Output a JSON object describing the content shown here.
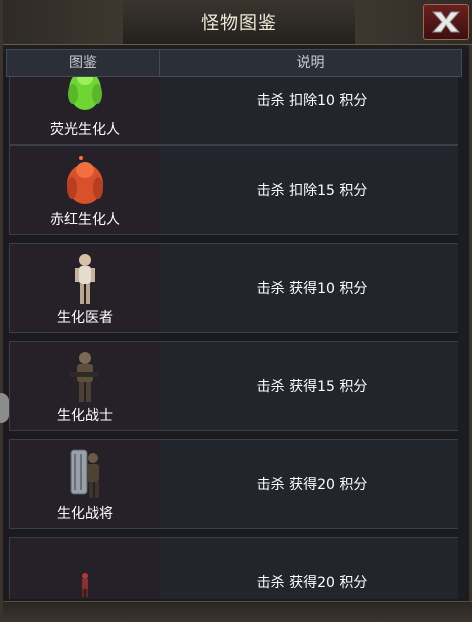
{
  "window": {
    "title": "怪物图鉴",
    "close_label": "X"
  },
  "table": {
    "headers": {
      "col1": "图鉴",
      "col2": "说明"
    },
    "rows": [
      {
        "name": "荧光生化人",
        "desc": "击杀 扣除10 积分",
        "icon": "green-mutant-icon",
        "color": "#7ee03a"
      },
      {
        "name": "赤红生化人",
        "desc": "击杀 扣除15 积分",
        "icon": "red-mutant-icon",
        "color": "#e0542a"
      },
      {
        "name": "生化医者",
        "desc": "击杀 获得10 积分",
        "icon": "nurse-zombie-icon",
        "color": "#c9b39a"
      },
      {
        "name": "生化战士",
        "desc": "击杀 获得15 积分",
        "icon": "soldier-zombie-icon",
        "color": "#6b5a44"
      },
      {
        "name": "生化战将",
        "desc": "击杀 获得20 积分",
        "icon": "armored-zombie-icon",
        "color": "#9aa0a8"
      },
      {
        "name": "",
        "desc": "击杀 获得20 积分",
        "icon": "small-zombie-icon",
        "color": "#b03a3a"
      }
    ]
  }
}
